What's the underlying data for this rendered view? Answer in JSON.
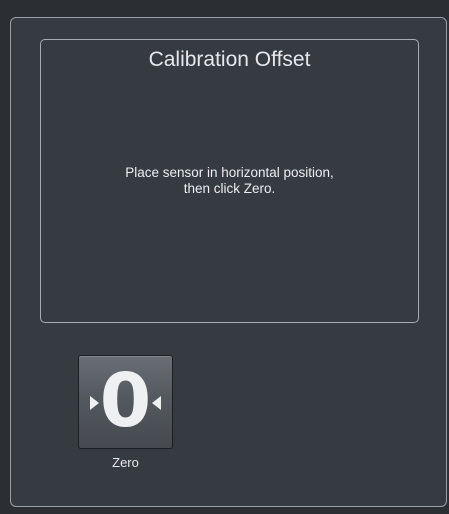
{
  "panel": {
    "title": "Calibration Offset",
    "instructions_line1": "Place sensor in horizontal position,",
    "instructions_line2": "then click Zero."
  },
  "zero_button": {
    "glyph": "0",
    "label": "Zero",
    "icon": "zero-icon"
  },
  "colors": {
    "background": "#2b2e33",
    "panel": "#363a41",
    "border": "#9a9ea6",
    "text": "#e6e8eb",
    "button": "#54585f"
  }
}
